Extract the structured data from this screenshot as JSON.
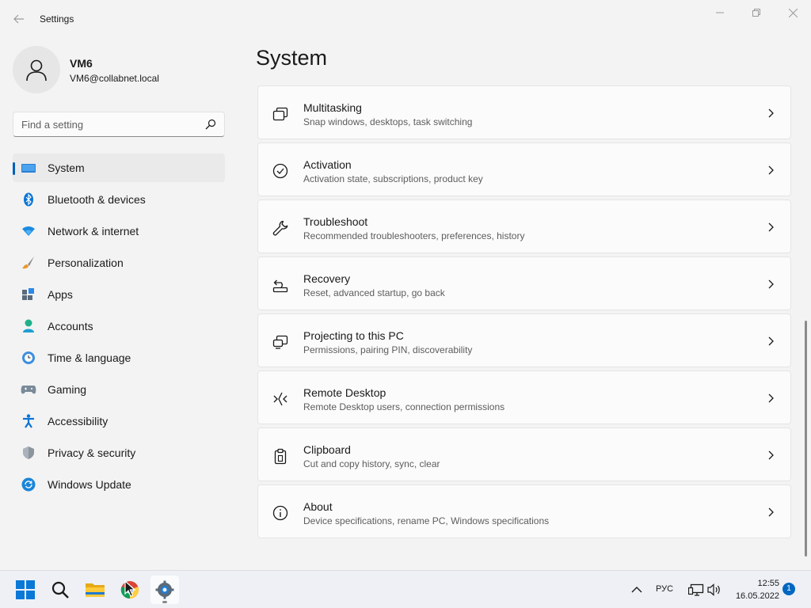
{
  "window": {
    "title": "Settings"
  },
  "user": {
    "name": "VM6",
    "email": "VM6@collabnet.local"
  },
  "search": {
    "placeholder": "Find a setting"
  },
  "sidebar": {
    "items": [
      {
        "label": "System",
        "icon": "monitor-icon",
        "active": true
      },
      {
        "label": "Bluetooth & devices",
        "icon": "bluetooth-icon"
      },
      {
        "label": "Network & internet",
        "icon": "wifi-icon"
      },
      {
        "label": "Personalization",
        "icon": "brush-icon"
      },
      {
        "label": "Apps",
        "icon": "apps-icon"
      },
      {
        "label": "Accounts",
        "icon": "account-icon"
      },
      {
        "label": "Time & language",
        "icon": "clock-globe-icon"
      },
      {
        "label": "Gaming",
        "icon": "gamepad-icon"
      },
      {
        "label": "Accessibility",
        "icon": "accessibility-icon"
      },
      {
        "label": "Privacy & security",
        "icon": "shield-icon"
      },
      {
        "label": "Windows Update",
        "icon": "update-icon"
      }
    ]
  },
  "main": {
    "title": "System",
    "items": [
      {
        "title": "Multitasking",
        "desc": "Snap windows, desktops, task switching",
        "icon": "multitasking-icon"
      },
      {
        "title": "Activation",
        "desc": "Activation state, subscriptions, product key",
        "icon": "activation-check-icon"
      },
      {
        "title": "Troubleshoot",
        "desc": "Recommended troubleshooters, preferences, history",
        "icon": "wrench-icon"
      },
      {
        "title": "Recovery",
        "desc": "Reset, advanced startup, go back",
        "icon": "recovery-icon"
      },
      {
        "title": "Projecting to this PC",
        "desc": "Permissions, pairing PIN, discoverability",
        "icon": "projecting-icon"
      },
      {
        "title": "Remote Desktop",
        "desc": "Remote Desktop users, connection permissions",
        "icon": "remote-desktop-icon"
      },
      {
        "title": "Clipboard",
        "desc": "Cut and copy history, sync, clear",
        "icon": "clipboard-icon"
      },
      {
        "title": "About",
        "desc": "Device specifications, rename PC, Windows specifications",
        "icon": "info-icon"
      }
    ]
  },
  "taskbar": {
    "language": "РУС",
    "time": "12:55",
    "date": "16.05.2022",
    "notifications": "1"
  },
  "colors": {
    "accent": "#005fb8",
    "background": "#f3f3f3",
    "card": "#fbfbfb"
  }
}
